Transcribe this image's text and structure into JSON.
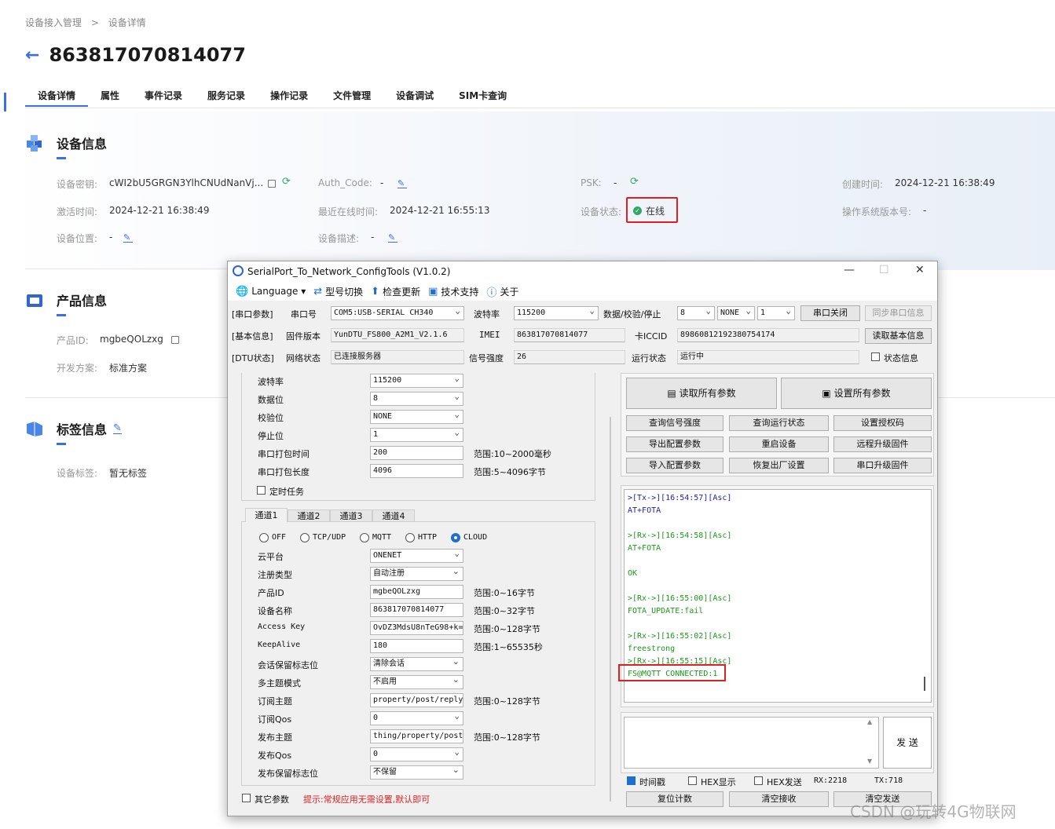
{
  "breadcrumb": [
    "设备接入管理",
    ">",
    "设备详情"
  ],
  "page_title": "863817070814077",
  "tabs": [
    "设备详情",
    "属性",
    "事件记录",
    "服务记录",
    "操作记录",
    "文件管理",
    "设备调试",
    "SIM卡查询"
  ],
  "device_info": {
    "title": "设备信息",
    "secret_label": "设备密钥:",
    "secret_value": "cWI2bU5GRGN3YlhCNUdNanVj...",
    "auth_label": "Auth_Code:",
    "auth_value": "-",
    "psk_label": "PSK:",
    "psk_value": "-",
    "created_label": "创建时间:",
    "created_value": "2024-12-21 16:38:49",
    "activated_label": "激活时间:",
    "activated_value": "2024-12-21 16:38:49",
    "last_online_label": "最近在线时间:",
    "last_online_value": "2024-12-21 16:55:13",
    "status_label": "设备状态:",
    "status_value": "在线",
    "os_label": "操作系统版本号:",
    "os_value": "-",
    "location_label": "设备位置:",
    "location_value": "-",
    "desc_label": "设备描述:",
    "desc_value": "-"
  },
  "product_info": {
    "title": "产品信息",
    "id_label": "产品ID:",
    "id_value": "mgbeQOLzxg",
    "scheme_label": "开发方案:",
    "scheme_value": "标准方案"
  },
  "tag_info": {
    "title": "标签信息",
    "tags_label": "设备标签:",
    "tags_value": "暂无标签"
  },
  "colors": {
    "accent": "#3b6ee8",
    "online": "#33a864",
    "highlight": "#e02020"
  },
  "dialog": {
    "title": "SerialPort_To_Network_ConfigTools (V1.0.2)",
    "window_buttons": [
      "—",
      "☐",
      "✕"
    ],
    "menu": [
      {
        "icon": "globe-icon",
        "glyph": "🌐",
        "label": "Language ▾"
      },
      {
        "icon": "switch-icon",
        "glyph": "⇄",
        "label": "型号切换"
      },
      {
        "icon": "upload-icon",
        "glyph": "⬆",
        "label": "检查更新"
      },
      {
        "icon": "support-icon",
        "glyph": "▣",
        "label": "技术支持"
      },
      {
        "icon": "info-icon",
        "glyph": "ⓘ",
        "label": "关于"
      }
    ],
    "row1": {
      "section": "[串口参数]",
      "port_label": "串口号",
      "port_value": "COM5:USB-SERIAL CH340",
      "baud_label": "波特率",
      "baud_value": "115200",
      "dps_label": "数据/校验/停止",
      "data_bits": "8",
      "parity": "NONE",
      "stop_bits": "1",
      "close_btn": "串口关闭",
      "sync_btn": "同步串口信息"
    },
    "row2": {
      "section": "[基本信息]",
      "fw_label": "固件版本",
      "fw_value": "YunDTU_FS800_A2M1_V2.1.6",
      "imei_label": "IMEI",
      "imei_value": "863817070814077",
      "iccid_label": "卡ICCID",
      "iccid_value": "89860812192380754174",
      "read_btn": "读取基本信息"
    },
    "row3": {
      "section": "[DTU状态]",
      "net_label": "网络状态",
      "net_value": "已连接服务器",
      "signal_label": "信号强度",
      "signal_value": "26",
      "run_label": "运行状态",
      "run_value": "运行中",
      "status_info": "状态信息"
    },
    "serial_settings": [
      {
        "label": "波特率",
        "value": "115200",
        "select": true,
        "range": ""
      },
      {
        "label": "数据位",
        "value": "8",
        "select": true,
        "range": ""
      },
      {
        "label": "校验位",
        "value": "NONE",
        "select": true,
        "range": ""
      },
      {
        "label": "停止位",
        "value": "1",
        "select": true,
        "range": ""
      },
      {
        "label": "串口打包时间",
        "value": "200",
        "select": false,
        "range": "范围:10~2000毫秒"
      },
      {
        "label": "串口打包长度",
        "value": "4096",
        "select": false,
        "range": "范围:5~4096字节"
      }
    ],
    "timer_task": "定时任务",
    "channel_tabs": [
      "通道1",
      "通道2",
      "通道3",
      "通道4"
    ],
    "protocols": [
      "OFF",
      "TCP/UDP",
      "MQTT",
      "HTTP",
      "CLOUD"
    ],
    "protocol_selected": "CLOUD",
    "channel_settings": [
      {
        "label": "云平台",
        "value": "ONENET",
        "select": true,
        "range": ""
      },
      {
        "label": "注册类型",
        "value": "自动注册",
        "select": true,
        "range": ""
      },
      {
        "label": "产品ID",
        "value": "mgbeQOLzxg",
        "select": false,
        "range": "范围:0~16字节"
      },
      {
        "label": "设备名称",
        "value": "863817070814077",
        "select": false,
        "range": "范围:0~32字节"
      },
      {
        "label": "Access Key",
        "value": "OvDZ3MdsU8nTeG98+k=",
        "select": false,
        "range": "范围:0~128字节"
      },
      {
        "label": "KeepAlive",
        "value": "180",
        "select": false,
        "range": "范围:1~65535秒"
      },
      {
        "label": "会话保留标志位",
        "value": "清除会话",
        "select": true,
        "range": ""
      },
      {
        "label": "多主题模式",
        "value": "不启用",
        "select": true,
        "range": ""
      },
      {
        "label": "订阅主题",
        "value": "property/post/reply",
        "select": false,
        "range": "范围:0~128字节"
      },
      {
        "label": "订阅Qos",
        "value": "0",
        "select": true,
        "range": ""
      },
      {
        "label": "发布主题",
        "value": "thing/property/post",
        "select": false,
        "range": "范围:0~128字节"
      },
      {
        "label": "发布Qos",
        "value": "0",
        "select": true,
        "range": ""
      },
      {
        "label": "发布保留标志位",
        "value": "不保留",
        "select": true,
        "range": ""
      }
    ],
    "other_params": "其它参数",
    "hint": "提示:常规应用无需设置,默认即可",
    "read_all": "读取所有参数",
    "set_all": "设置所有参数",
    "action_buttons": [
      "查询信号强度",
      "查询运行状态",
      "设置授权码",
      "导出配置参数",
      "重启设备",
      "远程升级固件",
      "导入配置参数",
      "恢复出厂设置",
      "串口升级固件"
    ],
    "log": [
      {
        "text": ">[Tx->][16:54:57][Asc]",
        "kind": "tx"
      },
      {
        "text": "AT+FOTA",
        "kind": "tx"
      },
      {
        "text": "",
        "kind": "rx"
      },
      {
        "text": ">[Rx->][16:54:58][Asc]",
        "kind": "rx"
      },
      {
        "text": "AT+FOTA",
        "kind": "rx"
      },
      {
        "text": "",
        "kind": "rx"
      },
      {
        "text": "OK",
        "kind": "rx"
      },
      {
        "text": "",
        "kind": "rx"
      },
      {
        "text": ">[Rx->][16:55:00][Asc]",
        "kind": "rx"
      },
      {
        "text": "FOTA_UPDATE:fail",
        "kind": "rx"
      },
      {
        "text": "",
        "kind": "rx"
      },
      {
        "text": ">[Rx->][16:55:02][Asc]",
        "kind": "rx"
      },
      {
        "text": "freestrong",
        "kind": "rx"
      },
      {
        "text": ">[Rx->][16:55:15][Asc]",
        "kind": "rx"
      },
      {
        "text": "FS@MQTT CONNECTED:1",
        "kind": "rx"
      }
    ],
    "send_btn": "发 送",
    "timestamp_cb": "时间戳",
    "hex_show": "HEX显示",
    "hex_send": "HEX发送",
    "rx_count": "RX:2218",
    "tx_count": "TX:718",
    "reset_count": "复位计数",
    "clear_rx": "清空接收",
    "clear_tx": "清空发送"
  },
  "watermark": "CSDN @玩转4G物联网"
}
